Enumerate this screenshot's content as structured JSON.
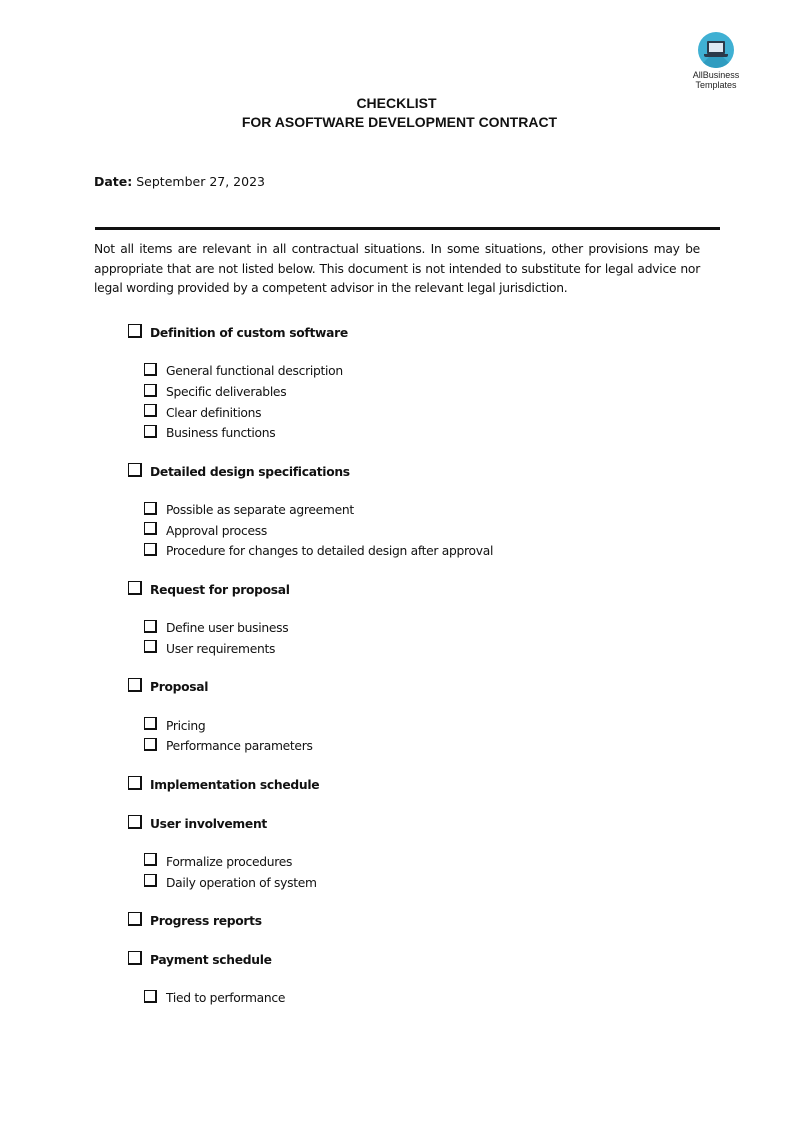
{
  "logo": {
    "icon": "laptop-icon",
    "line1": "AllBusiness",
    "line2": "Templates",
    "color": "#3fb0d3"
  },
  "header": {
    "title": "CHECKLIST",
    "subtitle": "FOR ASOFTWARE DEVELOPMENT CONTRACT"
  },
  "date": {
    "label": "Date:",
    "value": "September 27, 2023"
  },
  "intro": "Not all items are relevant in all contractual situations. In some situations, other provisions may be appropriate that are not listed below. This document is not intended to substitute for legal advice nor legal wording provided by a competent advisor in the relevant legal jurisdiction.",
  "checklist": [
    {
      "label": "Definition of custom software",
      "checked": false,
      "items": [
        {
          "label": "General functional description",
          "checked": false
        },
        {
          "label": "Specific deliverables",
          "checked": false
        },
        {
          "label": "Clear definitions",
          "checked": false
        },
        {
          "label": "Business functions",
          "checked": false
        }
      ]
    },
    {
      "label": "Detailed design specifications",
      "checked": false,
      "items": [
        {
          "label": "Possible as separate agreement",
          "checked": false
        },
        {
          "label": "Approval process",
          "checked": false
        },
        {
          "label": "Procedure for changes to detailed design after approval",
          "checked": false
        }
      ]
    },
    {
      "label": "Request for proposal",
      "checked": false,
      "items": [
        {
          "label": "Define user business",
          "checked": false
        },
        {
          "label": "User requirements",
          "checked": false
        }
      ]
    },
    {
      "label": "Proposal",
      "checked": false,
      "items": [
        {
          "label": "Pricing",
          "checked": false
        },
        {
          "label": "Performance parameters",
          "checked": false
        }
      ]
    },
    {
      "label": "Implementation schedule",
      "checked": false,
      "items": []
    },
    {
      "label": "User involvement",
      "checked": false,
      "items": [
        {
          "label": "Formalize procedures",
          "checked": false
        },
        {
          "label": "Daily operation of system",
          "checked": false
        }
      ]
    },
    {
      "label": "Progress reports",
      "checked": false,
      "items": []
    },
    {
      "label": "Payment schedule",
      "checked": false,
      "items": [
        {
          "label": "Tied to performance",
          "checked": false
        }
      ]
    }
  ]
}
